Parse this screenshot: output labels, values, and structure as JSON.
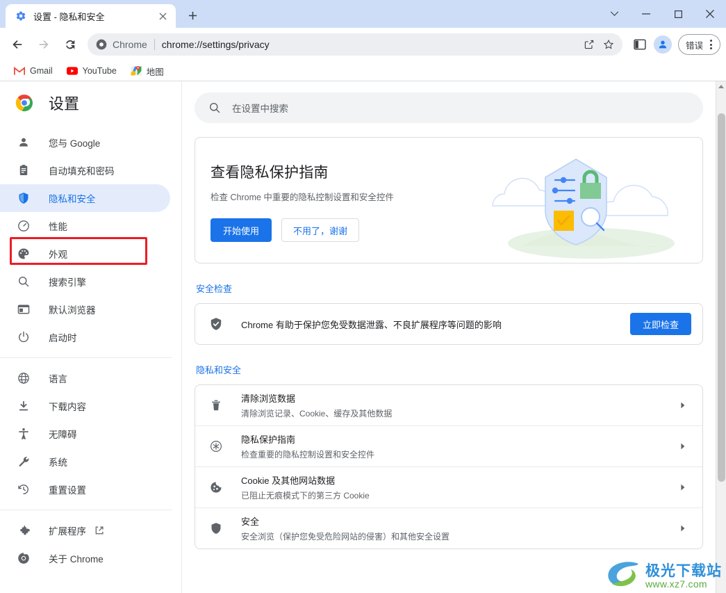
{
  "window": {
    "tab": {
      "title": "设置 - 隐私和安全",
      "favicon": "gear-icon",
      "close": "×"
    },
    "new_tab_label": "+",
    "controls": {
      "tablist": "⌄",
      "minimize": "—",
      "maximize": "□",
      "close": "✕"
    }
  },
  "toolbar": {
    "back": "←",
    "forward": "→",
    "reload": "⟳",
    "omnibox": {
      "prefix": "Chrome",
      "url": "chrome://settings/privacy",
      "share_icon": "share-icon",
      "bookmark_icon": "star-icon"
    },
    "side_panel_icon": "side-panel-icon",
    "profile_icon": "profile-avatar-icon",
    "menu_label": "错误"
  },
  "bookmarks": [
    {
      "label": "Gmail",
      "icon": "gmail-icon"
    },
    {
      "label": "YouTube",
      "icon": "youtube-icon"
    },
    {
      "label": "地图",
      "icon": "maps-icon"
    }
  ],
  "sidebar": {
    "brand": "设置",
    "groups": [
      {
        "items": [
          {
            "label": "您与 Google",
            "icon": "person-icon",
            "state": "normal"
          },
          {
            "label": "自动填充和密码",
            "icon": "clipboard-icon",
            "state": "highlighted"
          },
          {
            "label": "隐私和安全",
            "icon": "shield-icon",
            "state": "active"
          },
          {
            "label": "性能",
            "icon": "speedometer-icon",
            "state": "normal"
          },
          {
            "label": "外观",
            "icon": "palette-icon",
            "state": "normal"
          },
          {
            "label": "搜索引擎",
            "icon": "search-icon",
            "state": "normal"
          },
          {
            "label": "默认浏览器",
            "icon": "browser-window-icon",
            "state": "normal"
          },
          {
            "label": "启动时",
            "icon": "power-icon",
            "state": "normal"
          }
        ]
      },
      {
        "items": [
          {
            "label": "语言",
            "icon": "globe-icon",
            "state": "normal"
          },
          {
            "label": "下载内容",
            "icon": "download-icon",
            "state": "normal"
          },
          {
            "label": "无障碍",
            "icon": "accessibility-icon",
            "state": "normal"
          },
          {
            "label": "系统",
            "icon": "wrench-icon",
            "state": "normal"
          },
          {
            "label": "重置设置",
            "icon": "history-restore-icon",
            "state": "normal"
          }
        ]
      },
      {
        "items": [
          {
            "label": "扩展程序",
            "icon": "puzzle-icon",
            "state": "normal",
            "external": true
          },
          {
            "label": "关于 Chrome",
            "icon": "chrome-icon",
            "state": "normal"
          }
        ]
      }
    ]
  },
  "search": {
    "placeholder": "在设置中搜索",
    "icon": "search-icon"
  },
  "privacy_guide_card": {
    "title": "查看隐私保护指南",
    "subtitle": "检查 Chrome 中重要的隐私控制设置和安全控件",
    "primary_button": "开始使用",
    "secondary_button": "不用了，谢谢",
    "illustration": "privacy-shield-illustration"
  },
  "safety_check": {
    "section_title": "安全检查",
    "icon": "shield-check-icon",
    "description": "Chrome 有助于保护您免受数据泄露、不良扩展程序等问题的影响",
    "button": "立即检查"
  },
  "privacy_and_security": {
    "section_title": "隐私和安全",
    "rows": [
      {
        "icon": "trash-icon",
        "title": "清除浏览数据",
        "subtitle": "清除浏览记录、Cookie、缓存及其他数据",
        "arrow": "▸"
      },
      {
        "icon": "privacy-guide-icon",
        "title": "隐私保护指南",
        "subtitle": "检查重要的隐私控制设置和安全控件",
        "arrow": "▸"
      },
      {
        "icon": "cookie-icon",
        "title": "Cookie 及其他网站数据",
        "subtitle": "已阻止无痕模式下的第三方 Cookie",
        "arrow": "▸"
      },
      {
        "icon": "shield-icon",
        "title": "安全",
        "subtitle": "安全浏览（保护您免受危险网站的侵害）和其他安全设置",
        "arrow": "▸"
      }
    ]
  },
  "watermark": {
    "name": "极光下载站",
    "url": "www.xz7.com"
  },
  "colors": {
    "accent": "#1a73e8",
    "tabstrip": "#cdddf7",
    "active_pill": "#e4ecfb",
    "highlight_box": "#ee1c25",
    "text_primary": "#202124",
    "text_secondary": "#5f6368"
  }
}
